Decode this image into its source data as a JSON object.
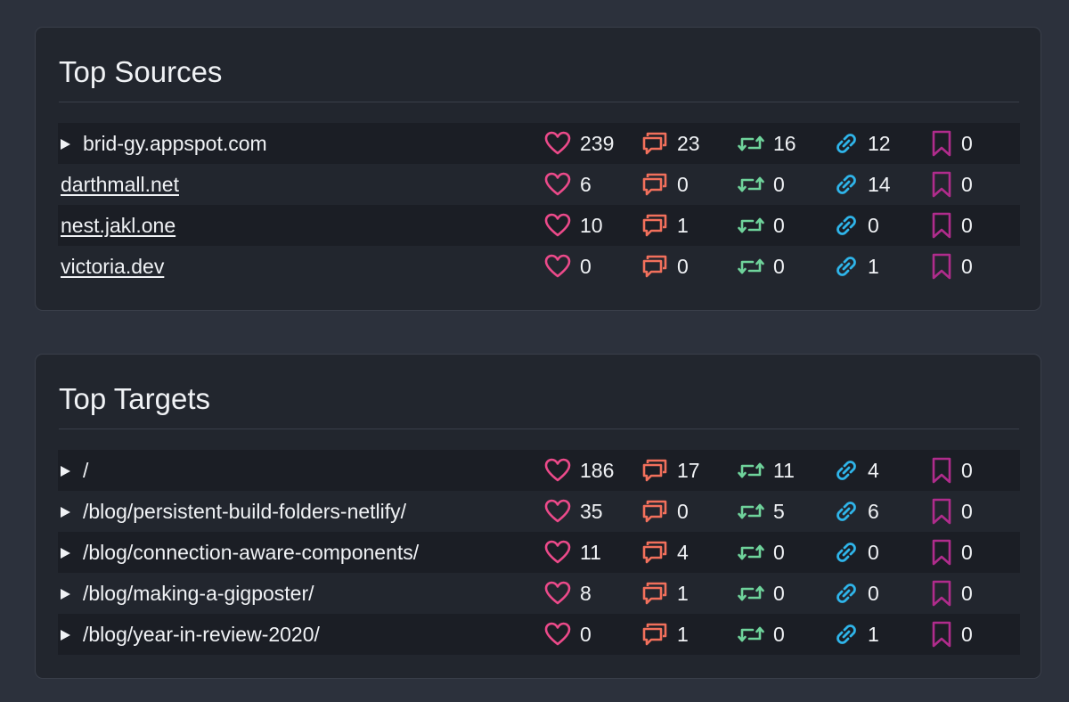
{
  "colors": {
    "like": "#ec4a8a",
    "reply": "#f2705c",
    "repost": "#6fd39b",
    "mention": "#2fb5ea",
    "bookmark": "#b02c8c"
  },
  "icons": [
    "heart-icon",
    "speech-bubbles-icon",
    "repost-icon",
    "link-icon",
    "bookmark-icon"
  ],
  "sources": {
    "title": "Top Sources",
    "rows": [
      {
        "name": "brid-gy.appspot.com",
        "expandable": true,
        "likes": "239",
        "replies": "23",
        "reposts": "16",
        "mentions": "12",
        "bookmarks": "0"
      },
      {
        "name": "darthmall.net",
        "expandable": false,
        "likes": "6",
        "replies": "0",
        "reposts": "0",
        "mentions": "14",
        "bookmarks": "0"
      },
      {
        "name": "nest.jakl.one",
        "expandable": false,
        "likes": "10",
        "replies": "1",
        "reposts": "0",
        "mentions": "0",
        "bookmarks": "0"
      },
      {
        "name": "victoria.dev",
        "expandable": false,
        "likes": "0",
        "replies": "0",
        "reposts": "0",
        "mentions": "1",
        "bookmarks": "0"
      }
    ]
  },
  "targets": {
    "title": "Top Targets",
    "rows": [
      {
        "name": "/",
        "expandable": true,
        "likes": "186",
        "replies": "17",
        "reposts": "11",
        "mentions": "4",
        "bookmarks": "0"
      },
      {
        "name": "/blog/persistent-build-folders-netlify/",
        "expandable": true,
        "likes": "35",
        "replies": "0",
        "reposts": "5",
        "mentions": "6",
        "bookmarks": "0"
      },
      {
        "name": "/blog/connection-aware-components/",
        "expandable": true,
        "likes": "11",
        "replies": "4",
        "reposts": "0",
        "mentions": "0",
        "bookmarks": "0"
      },
      {
        "name": "/blog/making-a-gigposter/",
        "expandable": true,
        "likes": "8",
        "replies": "1",
        "reposts": "0",
        "mentions": "0",
        "bookmarks": "0"
      },
      {
        "name": "/blog/year-in-review-2020/",
        "expandable": true,
        "likes": "0",
        "replies": "1",
        "reposts": "0",
        "mentions": "1",
        "bookmarks": "0"
      }
    ]
  }
}
